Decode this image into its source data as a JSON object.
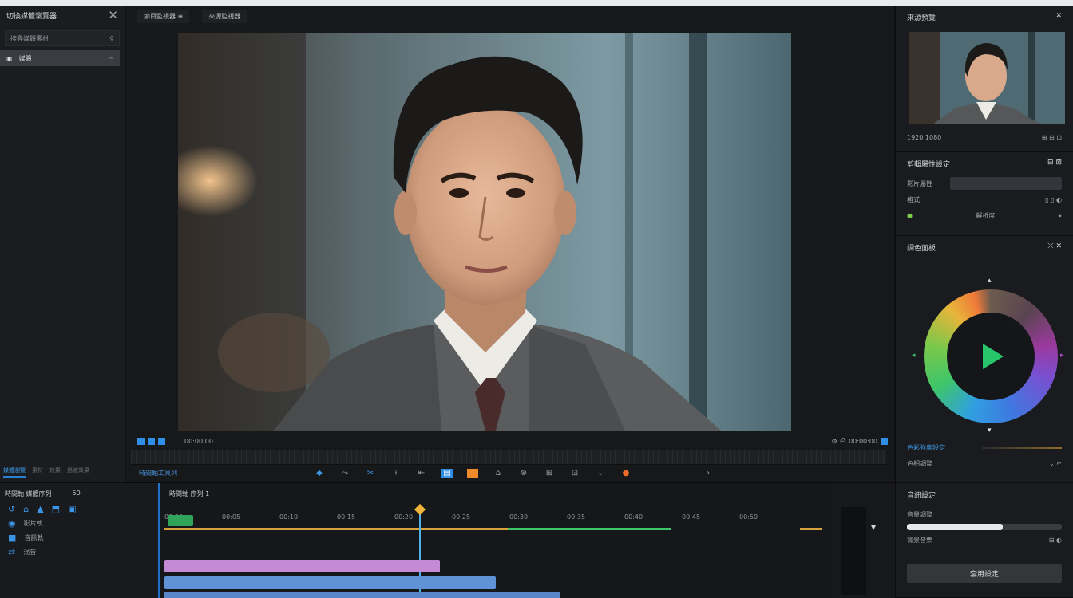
{
  "left_panel": {
    "title": "切換媒體瀏覽器",
    "search_placeholder": "搜尋媒體素材",
    "item_label": "媒體",
    "bottom_tabs": [
      "媒體瀏覽",
      "素材",
      "效果",
      "過渡效果"
    ]
  },
  "viewer": {
    "tabs": [
      "節目監視器 ≡",
      "來源監視器"
    ],
    "timecode_left": "00:00:00",
    "timecode_right": "00:00:00",
    "tools_label": "時間軸工具列"
  },
  "right_panel": {
    "preview_title": "來源預覽",
    "preview_info": "1920 1080",
    "props_title": "剪輯屬性設定",
    "props_row1_label": "影片屬性",
    "props_row2_label": "格式",
    "props_row3_label": "解析度",
    "color_title": "調色面板",
    "slider_label": "色彩強度設定",
    "color_row2_label": "色相調整",
    "audio_title": "音訊設定",
    "audio_label": "音量調整",
    "audio_sub": "背景音樂",
    "apply_button": "套用設定"
  },
  "timeline": {
    "header_label": "時間軸 媒體序列",
    "header_extra": "50",
    "title": "時間軸 序列 1",
    "ruler_marks": [
      "00:00",
      "00:05",
      "00:10",
      "00:15",
      "00:20",
      "00:25",
      "00:30",
      "00:35",
      "00:40",
      "00:45",
      "00:50"
    ],
    "track_rows": [
      "影片軌",
      "音訊軌",
      "混音"
    ]
  }
}
